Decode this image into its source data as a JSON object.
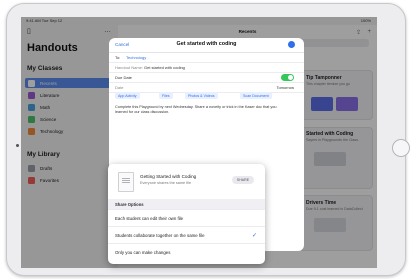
{
  "status_bar": {
    "time": "9:41 AM  Tue Sep 12",
    "battery": "100%"
  },
  "sidebar": {
    "title": "Handouts",
    "my_classes_label": "My Classes",
    "classes": [
      {
        "label": "Recents",
        "color": "#3a78f2",
        "selected": true
      },
      {
        "label": "Literature",
        "color": "#9b59d0",
        "selected": false
      },
      {
        "label": "Math",
        "color": "#4aa3df",
        "selected": false
      },
      {
        "label": "Science",
        "color": "#4cc26a",
        "selected": false
      },
      {
        "label": "Technology",
        "color": "#f08a3c",
        "selected": false
      }
    ],
    "my_library_label": "My Library",
    "library": [
      {
        "label": "Drafts",
        "color": "#9aa0a6"
      },
      {
        "label": "Favorites",
        "color": "#f25c5c"
      }
    ]
  },
  "main": {
    "title": "Recents",
    "search_placeholder": "Search",
    "cards": [
      {
        "title": "Tip Tamponner",
        "sub": "This chapter itemize you go"
      },
      {
        "title": "Started with Coding",
        "sub": "Sayers in Playgrounds the Class."
      },
      {
        "title": "Drivers Time",
        "sub": "Due 9-1 cost learned in DataCollect"
      }
    ]
  },
  "sheet": {
    "cancel_label": "Cancel",
    "title": "Get started with coding",
    "to_label": "To:",
    "to_value": "Technology",
    "handout_label": "Handout Name:",
    "handout_value": "Get started with coding",
    "due_date_label": "Due Date",
    "date_label": "Date",
    "date_value": "Tomorrow",
    "chips": [
      "App Activity",
      "Files",
      "Photos & Videos",
      "Scan Document"
    ],
    "description": "Complete this Playground by next Wednesday. Share a novelty or trick in the Kaser doc that you learned for our class discussion."
  },
  "popover": {
    "file_name": "Getting Started with Coding",
    "file_sub": "Everyone shares the same file",
    "file_chip": "SHARE",
    "section_label": "Share Options",
    "options": [
      {
        "label": "Each student can edit their own file",
        "checked": false
      },
      {
        "label": "Students collaborate together on the same file",
        "checked": true
      },
      {
        "label": "Only you can make changes",
        "checked": false
      }
    ]
  },
  "colors": {
    "accent": "#2f6fe8",
    "toggle_on": "#34c759"
  },
  "icons": {
    "sidebar_toggle": "sidebar-icon",
    "more": "ellipsis-icon",
    "add": "plus-icon",
    "check": "checkmark-icon"
  }
}
